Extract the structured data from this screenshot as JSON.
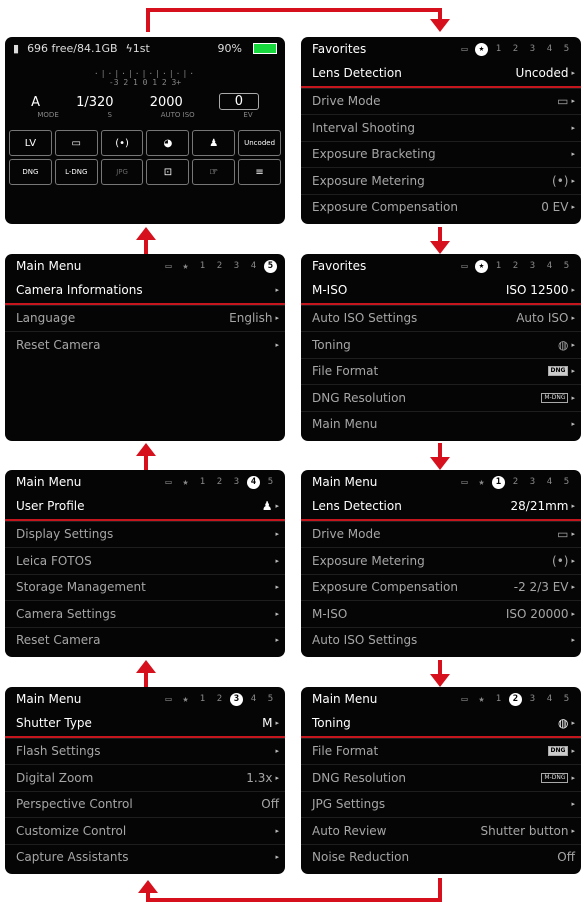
{
  "status_screen": {
    "storage": "696 free/84.1GB",
    "flash": "ϟ1st",
    "battery": "90%",
    "scale_marks": "·|·|·|·|·|·|·|·",
    "scale_nums": "-3  2  1  0  1  2  3+",
    "mode_value": "A",
    "mode_label": "MODE",
    "shutter_value": "1/320",
    "shutter_label": "S",
    "iso_value": "2000",
    "iso_label": "AUTO ISO",
    "ev_value": "0",
    "ev_label": "EV",
    "quick_row1": [
      "LV",
      "▭",
      "(•)",
      "◕",
      "♟",
      "Uncoded"
    ],
    "quick_row2": [
      "DNG",
      "L-DNG",
      "JPG",
      "⊡",
      "☞",
      "≡"
    ]
  },
  "screens": [
    {
      "title": "Favorites",
      "tabs": [
        "▭",
        "★",
        "1",
        "2",
        "3",
        "4",
        "5"
      ],
      "active": 1,
      "rows": [
        {
          "label": "Lens Detection",
          "value": "Uncoded"
        },
        {
          "label": "Drive Mode",
          "value": "▭"
        },
        {
          "label": "Interval Shooting",
          "value": ""
        },
        {
          "label": "Exposure Bracketing",
          "value": ""
        },
        {
          "label": "Exposure Metering",
          "value": "(•)"
        },
        {
          "label": "Exposure Compensation",
          "value": "0 EV"
        }
      ]
    },
    {
      "title": "Main Menu",
      "tabs": [
        "▭",
        "★",
        "1",
        "2",
        "3",
        "4",
        "5"
      ],
      "active": 6,
      "rows": [
        {
          "label": "Camera Informations",
          "value": ""
        },
        {
          "label": "Language",
          "value": "English"
        },
        {
          "label": "Reset Camera",
          "value": ""
        }
      ]
    },
    {
      "title": "Favorites",
      "tabs": [
        "▭",
        "★",
        "1",
        "2",
        "3",
        "4",
        "5"
      ],
      "active": 1,
      "rows": [
        {
          "label": "M-ISO",
          "value": "ISO 12500"
        },
        {
          "label": "Auto ISO Settings",
          "value": "Auto ISO"
        },
        {
          "label": "Toning",
          "value": "◍"
        },
        {
          "label": "File Format",
          "value": "DNG"
        },
        {
          "label": "DNG Resolution",
          "value": "M-DNG"
        },
        {
          "label": "Main Menu",
          "value": ""
        }
      ]
    },
    {
      "title": "Main Menu",
      "tabs": [
        "▭",
        "★",
        "1",
        "2",
        "3",
        "4",
        "5"
      ],
      "active": 5,
      "rows": [
        {
          "label": "User Profile",
          "value": "♟"
        },
        {
          "label": "Display Settings",
          "value": ""
        },
        {
          "label": "Leica FOTOS",
          "value": ""
        },
        {
          "label": "Storage Management",
          "value": ""
        },
        {
          "label": "Camera Settings",
          "value": ""
        },
        {
          "label": "Reset Camera",
          "value": ""
        }
      ]
    },
    {
      "title": "Main Menu",
      "tabs": [
        "▭",
        "★",
        "1",
        "2",
        "3",
        "4",
        "5"
      ],
      "active": 2,
      "rows": [
        {
          "label": "Lens Detection",
          "value": "28/21mm"
        },
        {
          "label": "Drive Mode",
          "value": "▭"
        },
        {
          "label": "Exposure Metering",
          "value": "(•)"
        },
        {
          "label": "Exposure Compensation",
          "value": "-2 2/3 EV"
        },
        {
          "label": "M-ISO",
          "value": "ISO 20000"
        },
        {
          "label": "Auto ISO Settings",
          "value": ""
        }
      ]
    },
    {
      "title": "Main Menu",
      "tabs": [
        "▭",
        "★",
        "1",
        "2",
        "3",
        "4",
        "5"
      ],
      "active": 4,
      "rows": [
        {
          "label": "Shutter Type",
          "value": "M"
        },
        {
          "label": "Flash Settings",
          "value": ""
        },
        {
          "label": "Digital Zoom",
          "value": "1.3x"
        },
        {
          "label": "Perspective Control",
          "value": "Off"
        },
        {
          "label": "Customize Control",
          "value": ""
        },
        {
          "label": "Capture Assistants",
          "value": ""
        }
      ]
    },
    {
      "title": "Main Menu",
      "tabs": [
        "▭",
        "★",
        "1",
        "2",
        "3",
        "4",
        "5"
      ],
      "active": 3,
      "rows": [
        {
          "label": "Toning",
          "value": "◍"
        },
        {
          "label": "File Format",
          "value": "DNG"
        },
        {
          "label": "DNG Resolution",
          "value": "M-DNG"
        },
        {
          "label": "JPG Settings",
          "value": ""
        },
        {
          "label": "Auto Review",
          "value": "Shutter button"
        },
        {
          "label": "Noise Reduction",
          "value": "Off"
        }
      ]
    }
  ],
  "colors": {
    "accent": "#d6101c",
    "battery": "#17d93d"
  }
}
